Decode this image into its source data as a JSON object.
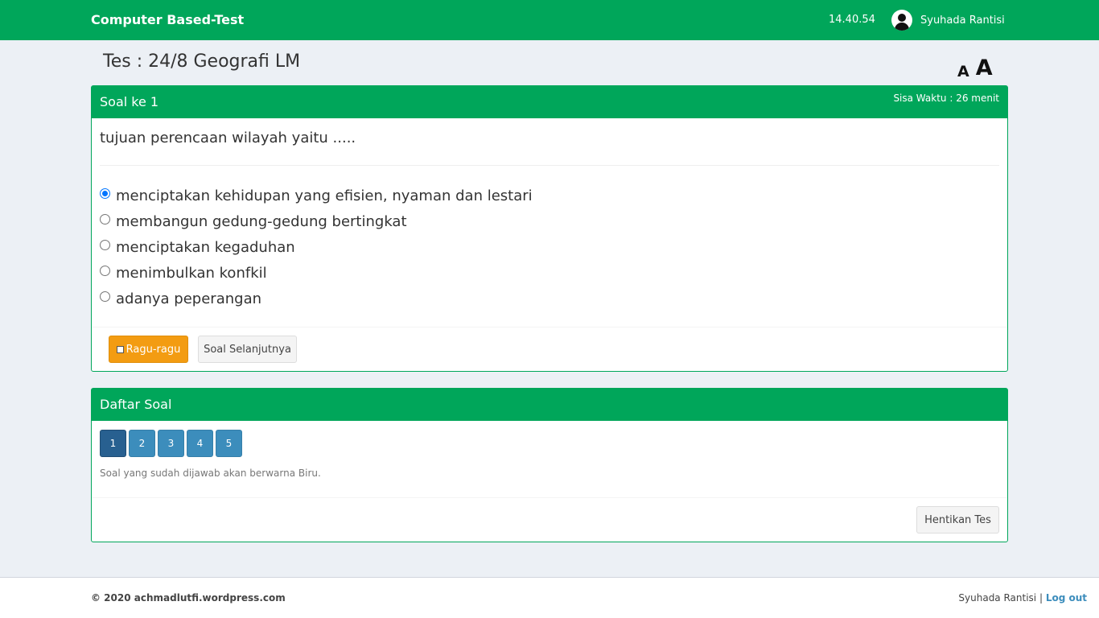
{
  "navbar": {
    "brand": "Computer Based-Test",
    "clock": "14.40.54",
    "user_name": "Syuhada Rantisi",
    "user_icon": "user-circle-icon"
  },
  "page": {
    "title": "Tes : 24/8 Geografi LM",
    "font_small_label": "A",
    "font_large_label": "A"
  },
  "question": {
    "header": "Soal ke 1",
    "timer": "Sisa Waktu : 26 menit",
    "text": "tujuan perencaan wilayah yaitu .....",
    "options": [
      {
        "label": "menciptakan kehidupan yang efisien, nyaman dan lestari",
        "checked": true
      },
      {
        "label": "membangun gedung-gedung bertingkat",
        "checked": false
      },
      {
        "label": "menciptakan kegaduhan",
        "checked": false
      },
      {
        "label": "menimbulkan konfkil",
        "checked": false
      },
      {
        "label": "adanya peperangan",
        "checked": false
      }
    ],
    "doubt_label": "Ragu-ragu",
    "next_label": "Soal Selanjutnya"
  },
  "list": {
    "header": "Daftar Soal",
    "numbers": [
      "1",
      "2",
      "3",
      "4",
      "5"
    ],
    "active_number": "1",
    "hint": "Soal yang sudah dijawab akan berwarna Biru.",
    "stop_label": "Hentikan Tes"
  },
  "footer": {
    "copyright": "© 2020 achmadlutfi.wordpress.com",
    "user_name": "Syuhada Rantisi",
    "separator": " | ",
    "logout_label": "Log out"
  },
  "colors": {
    "brand_green": "#00a65a",
    "warning_orange": "#f39c12",
    "primary_blue": "#3c8dbc",
    "active_blue": "#286090"
  }
}
